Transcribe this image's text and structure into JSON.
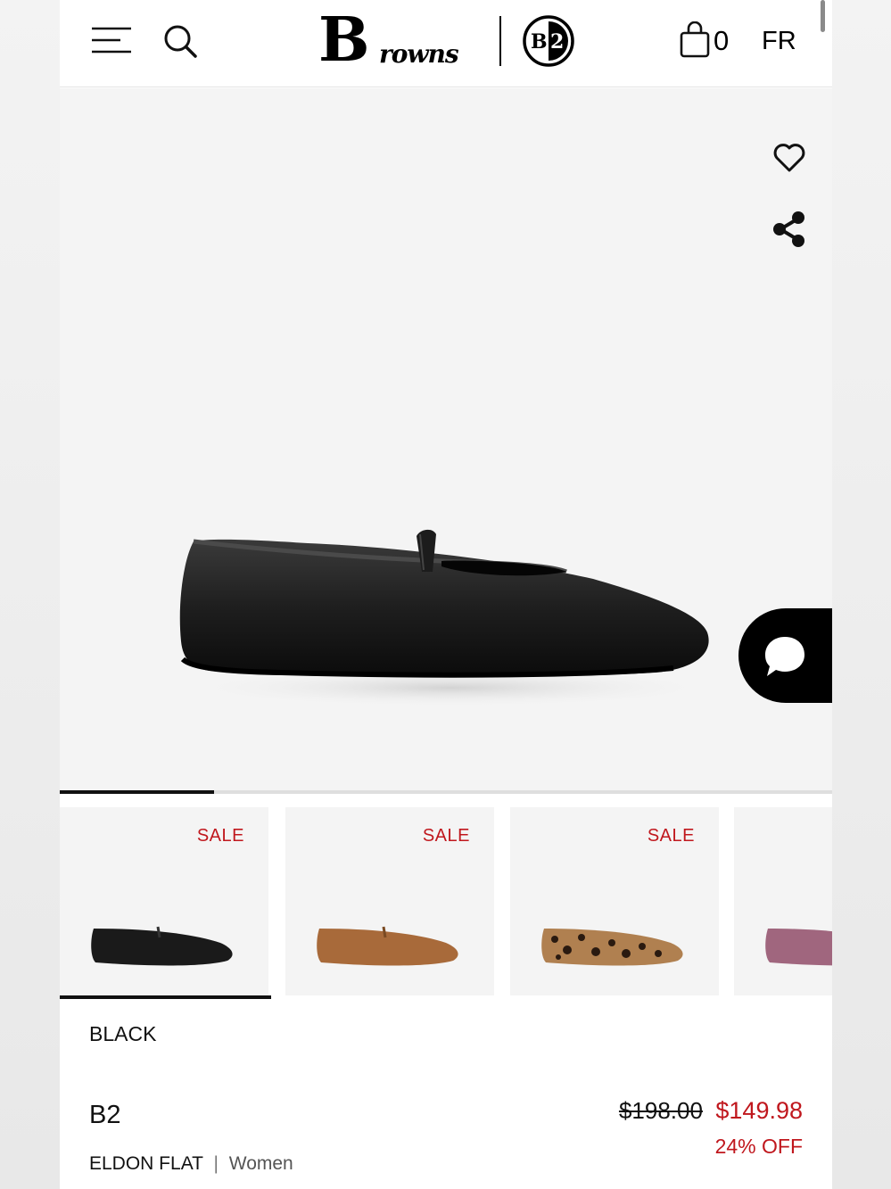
{
  "header": {
    "logo_text": "Browns",
    "logo_badge": "B2",
    "bag_count": "0",
    "language": "FR"
  },
  "hero": {
    "icons": [
      "heart-icon",
      "share-icon",
      "chat-icon"
    ],
    "gallery_progress": 0.2
  },
  "thumbnails": [
    {
      "badge": "SALE",
      "color": "#1a1a1a",
      "selected": true
    },
    {
      "badge": "SALE",
      "color": "#a86a3a",
      "selected": false
    },
    {
      "badge": "SALE",
      "color": "#8a5a2e",
      "selected": false
    },
    {
      "badge": "",
      "color": "#a0667e",
      "selected": false
    }
  ],
  "product": {
    "color": "BLACK",
    "brand": "B2",
    "name": "ELDON FLAT",
    "separator": "|",
    "gender": "Women",
    "original_price": "$198.00",
    "sale_price": "$149.98",
    "discount": "24% OFF"
  },
  "colors": {
    "sale_red": "#c0171d",
    "text": "#111111",
    "image_bg": "#f4f4f4"
  }
}
